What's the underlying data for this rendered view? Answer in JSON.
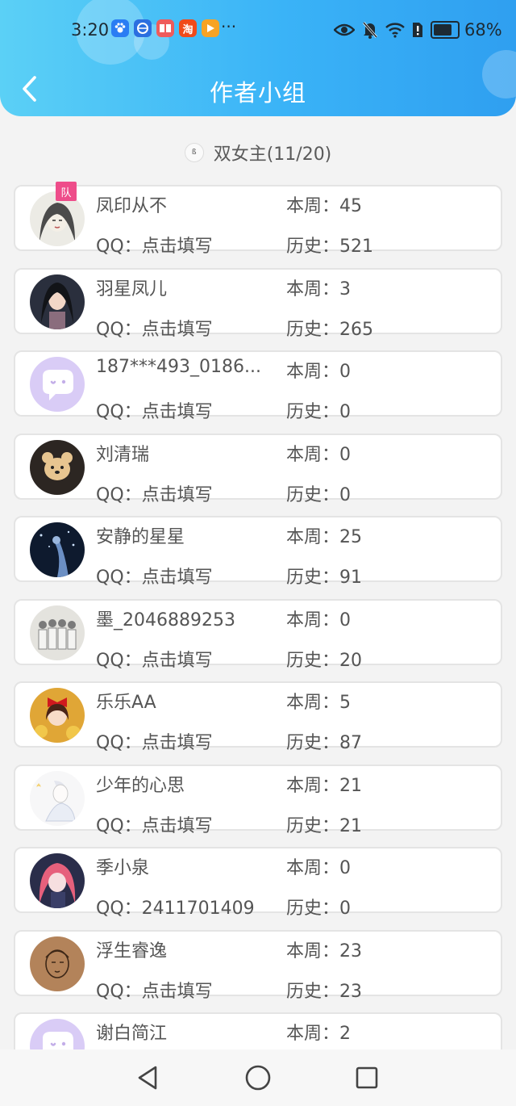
{
  "status_bar": {
    "time": "3:20",
    "more": "···",
    "battery": "68%",
    "battery_level": 0.68,
    "app_icon_5_glyph": "淘"
  },
  "header": {
    "title": "作者小组",
    "accent_start": "#5bd0f6",
    "accent_end": "#2f9ff0"
  },
  "group": {
    "icon_glyph": "ß",
    "label": "双女主(11/20)"
  },
  "members": [
    {
      "name": "凤印从不",
      "qq": "QQ：点击填写",
      "week": "本周：45",
      "history": "历史：521",
      "badge": "队",
      "avatar_icon": "portrait-sketch-avatar"
    },
    {
      "name": "羽星凤儿",
      "qq": "QQ：点击填写",
      "week": "本周：3",
      "history": "历史：265",
      "avatar_icon": "girl-portrait-avatar"
    },
    {
      "name": "187***493_0186...",
      "qq": "QQ：点击填写",
      "week": "本周：0",
      "history": "历史：0",
      "avatar_icon": "default-chat-avatar"
    },
    {
      "name": "刘清瑞",
      "qq": "QQ：点击填写",
      "week": "本周：0",
      "history": "历史：0",
      "avatar_icon": "bear-avatar"
    },
    {
      "name": "安静的星星",
      "qq": "QQ：点击填写",
      "week": "本周：25",
      "history": "历史：91",
      "avatar_icon": "starry-night-avatar"
    },
    {
      "name": "墨_2046889253",
      "qq": "QQ：点击填写",
      "week": "本周：0",
      "history": "历史：20",
      "avatar_icon": "group-sketch-avatar"
    },
    {
      "name": "乐乐AA",
      "qq": "QQ：点击填写",
      "week": "本周：5",
      "history": "历史：87",
      "avatar_icon": "girl-red-bow-avatar"
    },
    {
      "name": "少年的心思",
      "qq": "QQ：点击填写",
      "week": "本周：21",
      "history": "历史：21",
      "avatar_icon": "boy-sketch-avatar"
    },
    {
      "name": "季小泉",
      "qq": "QQ：2411701409",
      "week": "本周：0",
      "history": "历史：0",
      "avatar_icon": "pink-hair-avatar"
    },
    {
      "name": "浮生睿逸",
      "qq": "QQ：点击填写",
      "week": "本周：23",
      "history": "历史：23",
      "avatar_icon": "brown-sketch-avatar"
    },
    {
      "name": "谢白简江",
      "qq": "",
      "week": "本周：2",
      "history": "",
      "avatar_icon": "default-chat-avatar"
    }
  ]
}
